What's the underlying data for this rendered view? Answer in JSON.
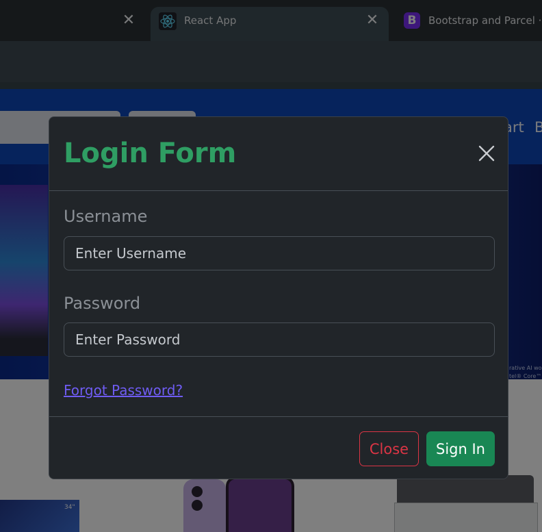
{
  "browser": {
    "tabs": [
      {
        "title": "",
        "active": false
      },
      {
        "title": "React App",
        "active": true,
        "icon": "react-icon"
      },
      {
        "title": "Bootstrap and Parcel · Bo",
        "active": false,
        "icon": "bootstrap-icon",
        "favicon_letter": "B"
      }
    ],
    "close_glyph": "✕"
  },
  "page": {
    "nav": {
      "links": [
        "art",
        "B"
      ]
    },
    "banner_fineprint": [
      "rative AI wor",
      "tel® Core™ U"
    ],
    "tv_label": "34\""
  },
  "modal": {
    "title": "Login Form",
    "username_label": "Username",
    "username_placeholder": "Enter Username",
    "password_label": "Password",
    "password_placeholder": "Enter Password",
    "forgot_link": "Forgot Password?",
    "close_button": "Close",
    "signin_button": "Sign In"
  },
  "colors": {
    "title_green": "#2f9e63",
    "close_red": "#dc3545",
    "signin_green": "#198754",
    "link_purple": "#6f5cf3",
    "modal_bg": "#212529"
  }
}
